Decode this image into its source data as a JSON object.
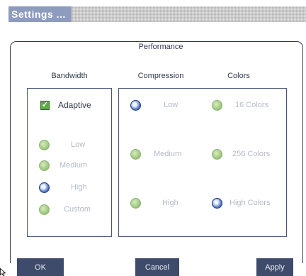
{
  "dialog": {
    "title": "Settings ..."
  },
  "performance": {
    "label": "Performance",
    "bandwidth": {
      "header": "Bandwidth",
      "adaptive": {
        "label": "Adaptive",
        "checked": true,
        "check_glyph": "✓"
      },
      "options": [
        {
          "label": "Low",
          "selected": false
        },
        {
          "label": "Medium",
          "selected": false
        },
        {
          "label": "High",
          "selected": true
        },
        {
          "label": "Custom",
          "selected": false
        }
      ]
    },
    "compression": {
      "header": "Compression",
      "options": [
        {
          "label": "Low",
          "selected": true
        },
        {
          "label": "Medium",
          "selected": false
        },
        {
          "label": "High",
          "selected": false
        }
      ]
    },
    "colors": {
      "header": "Colors",
      "options": [
        {
          "label": "16 Colors",
          "selected": false
        },
        {
          "label": "256 Colors",
          "selected": false
        },
        {
          "label": "High Colors",
          "selected": true
        }
      ]
    }
  },
  "buttons": {
    "ok": "OK",
    "cancel": "Cancel",
    "apply": "Apply"
  },
  "theme": {
    "title_bg": "#8d9bbd",
    "border": "#4a5678",
    "button_bg": "#3f4b6b",
    "radio_unselected": "#a6cc86",
    "radio_selected": "#213f93",
    "checkbox": "#5ea94a"
  }
}
